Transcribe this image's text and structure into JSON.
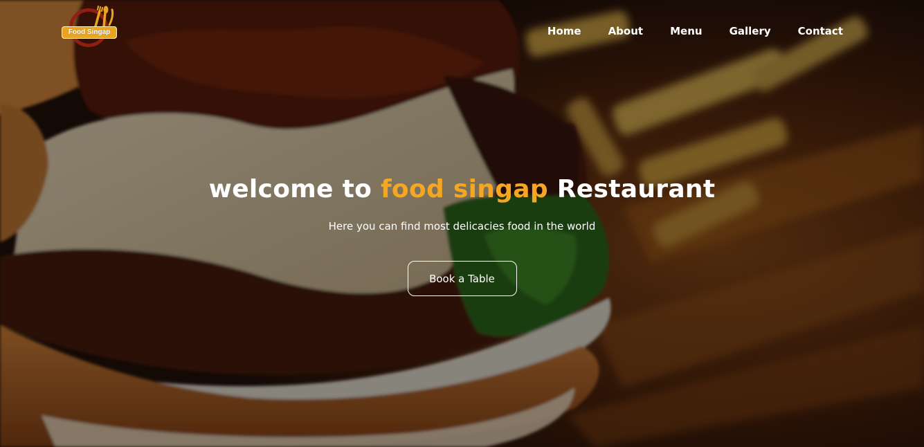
{
  "brand": {
    "logo_text": "Food Singap",
    "colors": {
      "accent": "#f5a623",
      "logo_ring": "#8e1f14",
      "logo_badge": "#e9a51f"
    }
  },
  "nav": {
    "items": [
      {
        "label": "Home"
      },
      {
        "label": "About"
      },
      {
        "label": "Menu"
      },
      {
        "label": "Gallery"
      },
      {
        "label": "Contact"
      }
    ]
  },
  "hero": {
    "title_prefix": "welcome to ",
    "title_accent": "food singap",
    "title_suffix": " Restaurant",
    "subtitle": "Here you can find most delicacies food in the world",
    "cta_label": "Book a Table",
    "background_image": "burger-photo"
  }
}
